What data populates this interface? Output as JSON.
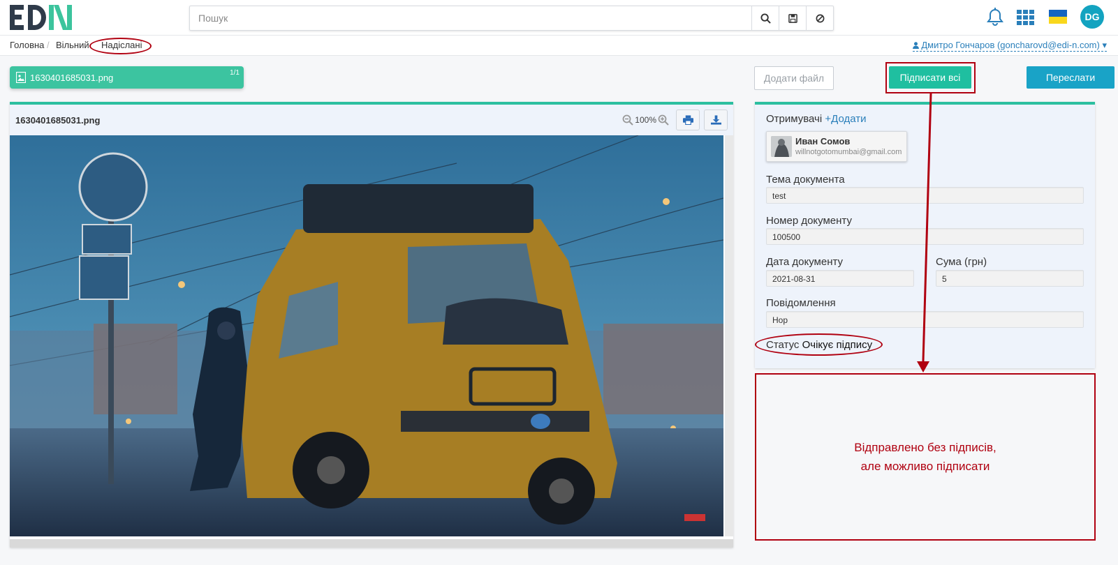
{
  "header": {
    "search_placeholder": "Пошук"
  },
  "breadcrumb": {
    "items": [
      "Головна",
      "Вільний",
      "Надіслані"
    ],
    "user": "Дмитро Гончаров (goncharovd@edi-n.com)"
  },
  "file_tab": {
    "name": "1630401685031.png",
    "count": "1/1"
  },
  "viewer": {
    "title": "1630401685031.png",
    "zoom": "100%"
  },
  "actions": {
    "add_file": "Додати файл",
    "sign_all": "Підписати всі",
    "forward": "Переслати"
  },
  "panel": {
    "recipients_label": "Отримувачі",
    "add_link": "+Додати",
    "recipient": {
      "name": "Иван Сомов",
      "email": "willnotgotomumbai@gmail.com"
    },
    "subject_label": "Тема документа",
    "subject_value": "test",
    "number_label": "Номер документу",
    "number_value": "100500",
    "date_label": "Дата документу",
    "date_value": "2021-08-31",
    "amount_label": "Сума (грн)",
    "amount_value": "5",
    "message_label": "Повідомлення",
    "message_value": "Нор",
    "status_label": "Статус",
    "status_value": "Очікує підпису"
  },
  "note": {
    "line1": "Відправлено без підписів,",
    "line2": "але можливо підписати"
  },
  "user_initials": "DG",
  "colors": {
    "accent": "#2cbfa0",
    "sign_button": "#1fbfa0",
    "forward_button": "#19a3c7",
    "annotation": "#b00010"
  }
}
